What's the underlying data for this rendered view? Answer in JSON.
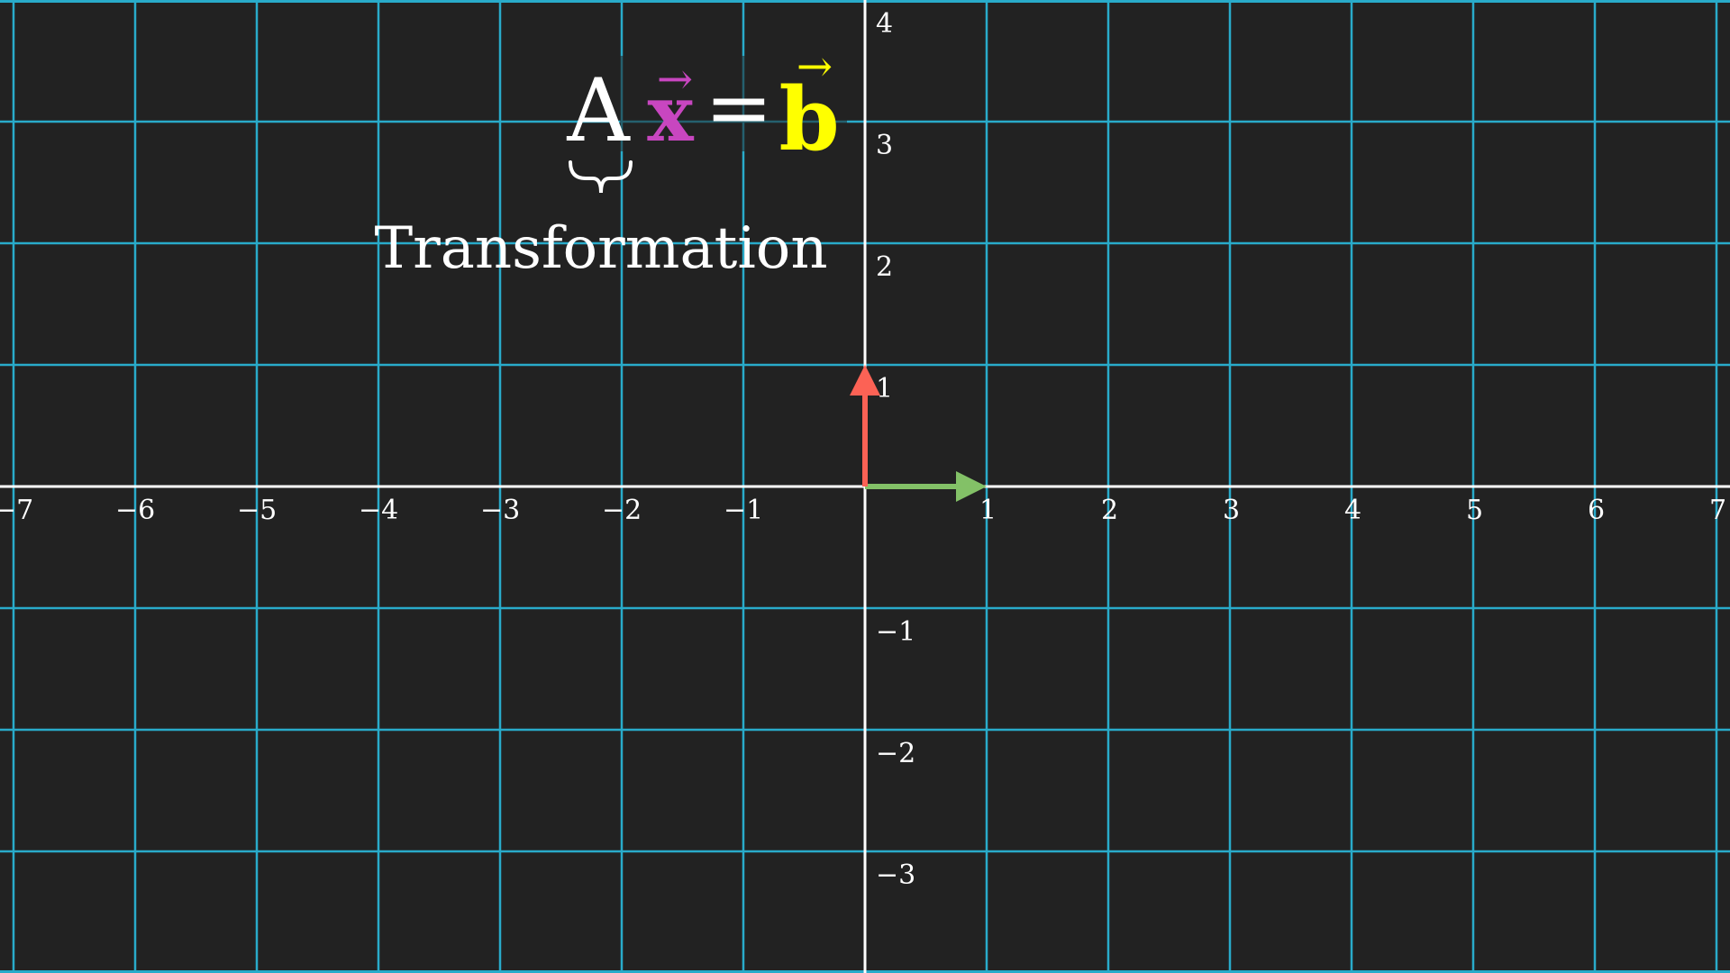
{
  "colors": {
    "background": "#222222",
    "grid_line": "#29abca",
    "axis": "#ffffff",
    "label": "#ffffff",
    "basis_i_hat": "#83c167",
    "basis_j_hat": "#fc6255",
    "x_vector": "#c846c0",
    "b_vector": "#ffff00"
  },
  "plane": {
    "x_range": [
      -7.1,
      7.1
    ],
    "y_range": [
      -4,
      4
    ],
    "x_tick_labels": [
      "−7",
      "−6",
      "−5",
      "−4",
      "−3",
      "−2",
      "−1",
      "1",
      "2",
      "3",
      "4",
      "5",
      "6",
      "7"
    ],
    "y_tick_labels": [
      "−3",
      "−2",
      "−1",
      "1",
      "2",
      "3",
      "4"
    ]
  },
  "basis_vectors": [
    {
      "name": "i-hat",
      "tip": [
        1,
        0
      ]
    },
    {
      "name": "j-hat",
      "tip": [
        0,
        1
      ]
    }
  ],
  "equation": {
    "matrix": "A",
    "x_symbol": "x",
    "equals": "=",
    "b_symbol": "b",
    "arrow": "→",
    "brace": "⏟"
  },
  "annotation": {
    "label": "Transformation"
  }
}
